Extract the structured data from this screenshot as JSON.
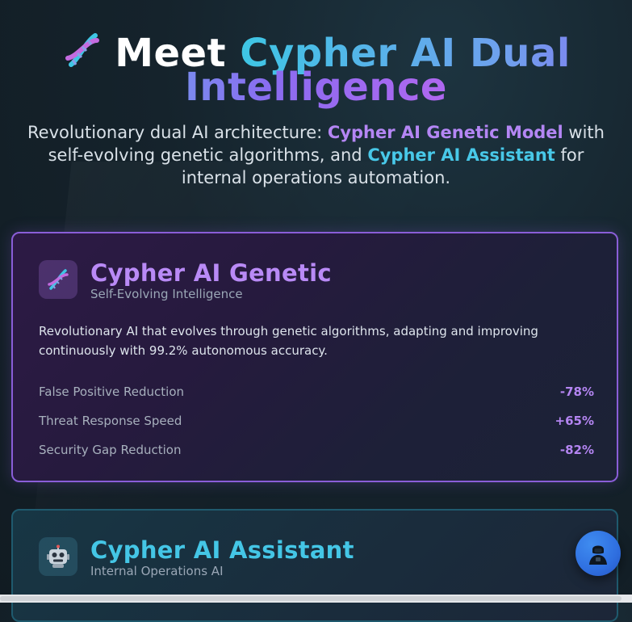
{
  "hero": {
    "title_part1": "Meet",
    "title_part2": "Cypher AI Dual Intelligence",
    "icon": "dna-icon",
    "subtitle_before": "Revolutionary dual AI architecture: ",
    "subtitle_highlight1": "Cypher AI Genetic Model",
    "subtitle_middle": " with self-evolving genetic algorithms, and ",
    "subtitle_highlight2": "Cypher AI Assistant",
    "subtitle_after": " for internal operations automation."
  },
  "genetic_card": {
    "icon": "dna-icon",
    "title": "Cypher AI Genetic",
    "subtitle": "Self-Evolving Intelligence",
    "description": "Revolutionary AI that evolves through genetic algorithms, adapting and improving continuously with 99.2% autonomous accuracy.",
    "metrics": [
      {
        "label": "False Positive Reduction",
        "value": "-78%"
      },
      {
        "label": "Threat Response Speed",
        "value": "+65%"
      },
      {
        "label": "Security Gap Reduction",
        "value": "-82%"
      }
    ]
  },
  "assistant_card": {
    "icon": "robot-icon",
    "title": "Cypher AI Assistant",
    "subtitle": "Internal Operations AI"
  },
  "chat_button": {
    "icon": "hacker-avatar-icon"
  },
  "colors": {
    "purple_accent": "#b98af6",
    "cyan_accent": "#44c6e6",
    "background": "#15232c",
    "chat_button": "#2f6fe0"
  }
}
